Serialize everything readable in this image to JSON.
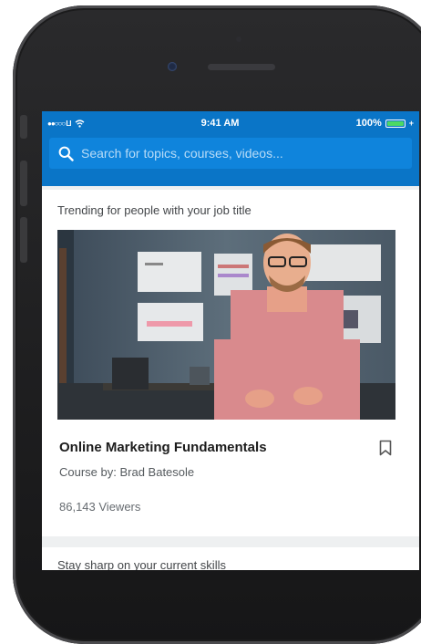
{
  "status_bar": {
    "carrier": "●●○○○ LI",
    "time": "9:41 AM",
    "battery": "100%",
    "battery_level": 1.0
  },
  "search": {
    "placeholder": "Search for topics, courses, videos..."
  },
  "trending": {
    "title": "Trending for people with your job title",
    "course": {
      "title": "Online Marketing Fundamentals",
      "author": "Course by: Brad Batesole",
      "viewers": "86,143 Viewers"
    }
  },
  "next_section": {
    "title": "Stay sharp on your current skills"
  },
  "colors": {
    "brand_blue": "#0a75c7",
    "search_box": "#0f84dc",
    "battery_green": "#4cd964"
  },
  "icons": [
    "wifi-icon",
    "battery-icon",
    "search-icon",
    "bookmark-icon"
  ]
}
